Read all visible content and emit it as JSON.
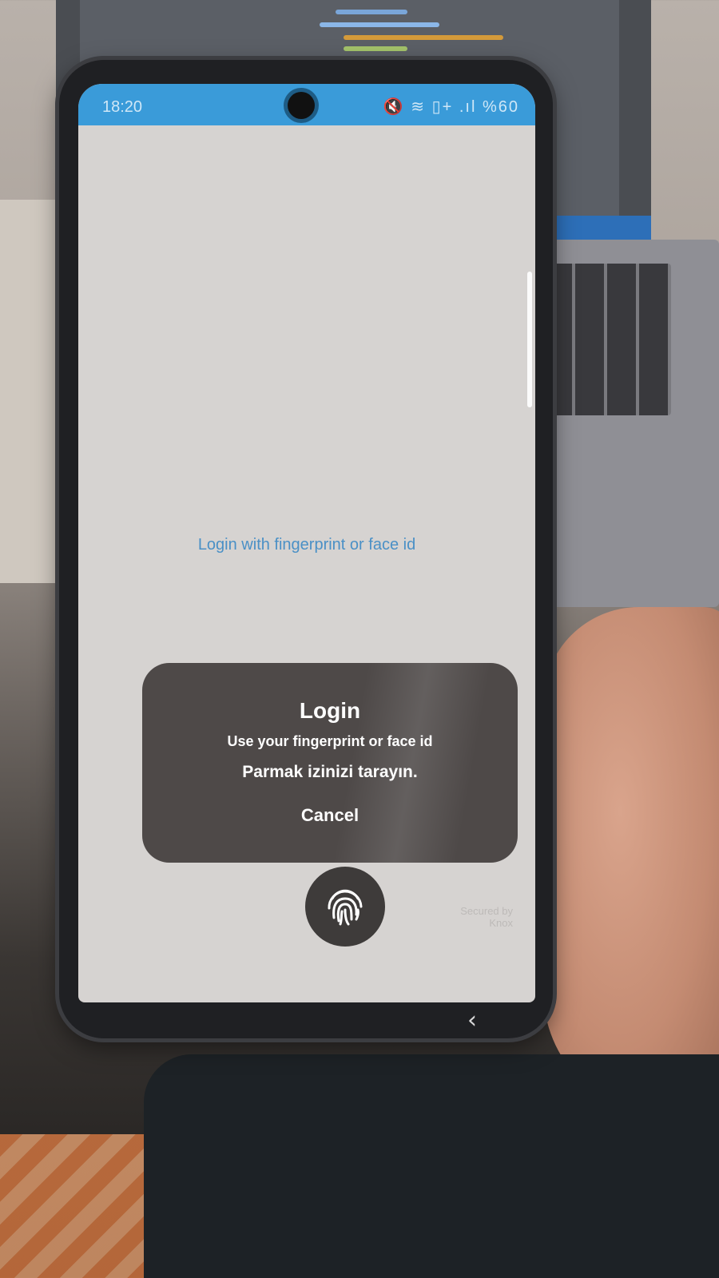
{
  "status_bar": {
    "time": "18:20",
    "icons": "🔇 ≋ ▯+ .ıl",
    "battery": "%60"
  },
  "main": {
    "login_hint": "Login with fingerprint or face id"
  },
  "biometric_dialog": {
    "title": "Login",
    "subtitle": "Use your fingerprint or face id",
    "description": "Parmak izinizi tarayın.",
    "cancel_label": "Cancel"
  },
  "footer": {
    "secured_line1": "Secured by",
    "secured_line2": "Knox"
  },
  "colors": {
    "status_bar": "#3a9bd9",
    "link_text": "#4a90c6",
    "dialog_bg": "#4e4948"
  },
  "icons": {
    "fingerprint": "fingerprint-icon",
    "back": "chevron-left-icon"
  }
}
